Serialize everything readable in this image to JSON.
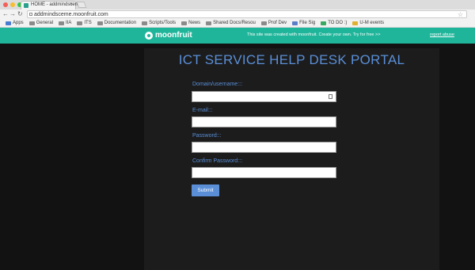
{
  "browser": {
    "tab_title": "HOME - addmindsceme",
    "tab_close": "×",
    "url": "addmindsceme.moonfruit.com",
    "bookmarks": [
      "Apps",
      "General",
      "IIA",
      "ITS",
      "Documentation",
      "Scripts/Tools",
      "News",
      "Shared Docs/Resou",
      "Prof Dev",
      "File Sig",
      "TO DO :)",
      "U-M events"
    ]
  },
  "banner": {
    "brand": "moonfruit",
    "promo": "This site was created with moonfruit. Create your own. Try for free >>",
    "report": "report abuse"
  },
  "form": {
    "title": "ICT SERVICE HELP DESK PORTAL",
    "username_label": "Domain/username:::",
    "email_label": "E-mail:::",
    "password_label": "Password:::",
    "confirm_label": "Confirm Password:::",
    "submit": "Submit"
  }
}
